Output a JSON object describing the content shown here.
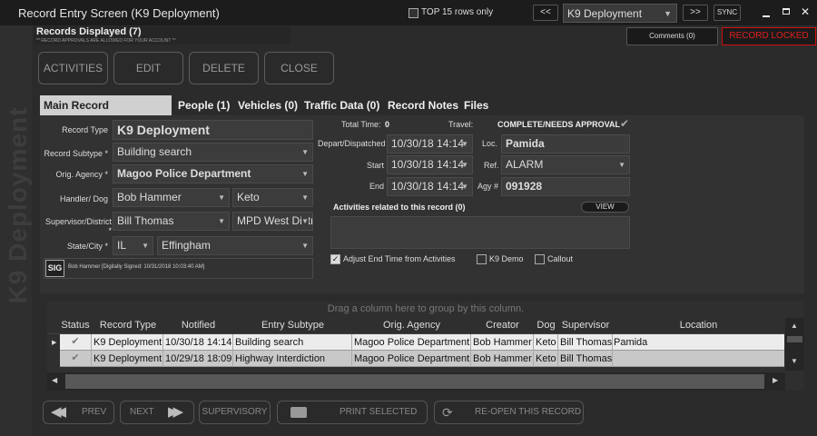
{
  "window": {
    "title": "Record Entry Screen (K9 Deployment)"
  },
  "top": {
    "top15_label": "TOP 15 rows only",
    "prev_label": "<<",
    "record_select": "K9 Deployment",
    "next_label": ">>",
    "sync_label": "SYNC"
  },
  "info": {
    "records_displayed": "Records Displayed (7)",
    "approvals_note": "** RECORD APPROVALS ARE ALLOWED FOR YOUR ACCOUNT **",
    "comments_label": "Comments (0)",
    "locked_label": "RECORD LOCKED"
  },
  "sidebar": {
    "text": "K9 Deployment"
  },
  "actions": [
    "ACTIVITIES",
    "EDIT",
    "DELETE",
    "CLOSE"
  ],
  "tabs": [
    "Main Record Information",
    "People (1)",
    "Vehicles (0)",
    "Traffic Data (0)",
    "Record Notes",
    "Files"
  ],
  "form": {
    "record_type_label": "Record Type",
    "record_type": "K9 Deployment",
    "subtype_label": "Record Subtype *",
    "subtype": "Building search",
    "agency_label": "Orig. Agency *",
    "agency": "Magoo Police Department",
    "handler_label": "Handler/ Dog",
    "handler": "Bob Hammer",
    "dog": "Keto",
    "supervisor_label": "Supervisor/District *",
    "supervisor": "Bill Thomas",
    "district": "MPD West Distri",
    "state_label": "State/City *",
    "state": "IL",
    "city": "Effingham",
    "sig_label": "SIG",
    "sig_text": "Bob Hammer [Digitally Signed: 10/31/2018 10:03:40 AM]",
    "total_time_label": "Total Time:",
    "total_time": "0",
    "travel_label": "Travel:",
    "status": "COMPLETE/NEEDS APPROVAL",
    "depart_label": "Depart/Dispatched",
    "depart": "10/30/18 14:14",
    "start_label": "Start",
    "start": "10/30/18 14:14",
    "end_label": "End",
    "end": "10/30/18 14:14",
    "loc_label": "Loc.",
    "loc": "Pamida",
    "ref_label": "Ref.",
    "ref": "ALARM",
    "agy_label": "Agy #",
    "agy": "091928",
    "activities_label": "Activities related to this record (0)",
    "view_label": "VIEW",
    "adjust_label": "Adjust End Time from Activities",
    "k9demo_label": "K9 Demo",
    "callout_label": "Callout"
  },
  "grid": {
    "group_hint": "Drag a column here to group by this column.",
    "columns": [
      "Status",
      "Record Type",
      "Notified",
      "Entry Subtype",
      "Orig. Agency",
      "Creator",
      "Dog",
      "Supervisor",
      "Location"
    ],
    "rows": [
      [
        "✔",
        "K9 Deployment",
        "10/30/18 14:14",
        "Building search",
        "Magoo Police Department",
        "Bob Hammer",
        "Keto",
        "Bill Thomas",
        "Pamida"
      ],
      [
        "✔",
        "K9 Deployment",
        "10/29/18 18:09",
        "Highway Interdiction",
        "Magoo Police Department",
        "Bob Hammer",
        "Keto",
        "Bill Thomas",
        ""
      ]
    ]
  },
  "bottom": {
    "prev": "PREV",
    "next": "NEXT",
    "supervisory": "SUPERVISORY",
    "print": "PRINT SELECTED",
    "reopen": "RE-OPEN THIS RECORD"
  }
}
